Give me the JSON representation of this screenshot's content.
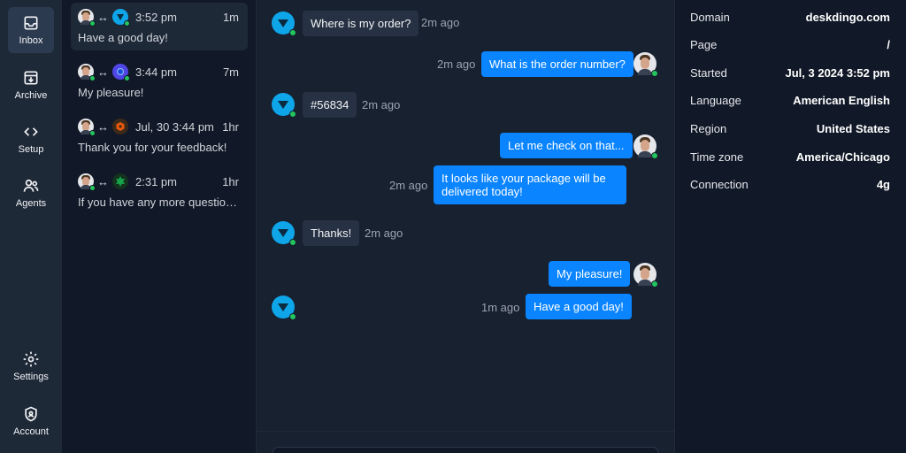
{
  "nav": {
    "inbox": "Inbox",
    "archive": "Archive",
    "setup": "Setup",
    "agents": "Agents",
    "settings": "Settings",
    "account": "Account"
  },
  "conversations": [
    {
      "time": "3:52 pm",
      "ago": "1m",
      "message": "Have a good day!",
      "brand": "bot-blue"
    },
    {
      "time": "3:44 pm",
      "ago": "7m",
      "message": "My pleasure!",
      "brand": "bot-purple"
    },
    {
      "time": "Jul, 30 3:44 pm",
      "ago": "1hr",
      "message": "Thank you for your feedback!",
      "brand": "bot-orange"
    },
    {
      "time": "2:31 pm",
      "ago": "1hr",
      "message": "If you have any more questions…",
      "brand": "bot-green"
    }
  ],
  "messages": [
    {
      "from": "visitor",
      "text": "Where is my order?",
      "time": "2m ago"
    },
    {
      "from": "agent",
      "text": "What is the order number?",
      "time": "2m ago"
    },
    {
      "from": "visitor",
      "text": "#56834",
      "time": "2m ago"
    },
    {
      "from": "agent",
      "text": "Let me check on that...",
      "time": ""
    },
    {
      "from": "agent",
      "text": "It looks like your package will be delivered today!",
      "time": "2m ago"
    },
    {
      "from": "visitor",
      "text": "Thanks!",
      "time": "2m ago"
    },
    {
      "from": "agent",
      "text": "My pleasure!",
      "time": ""
    },
    {
      "from": "agent",
      "text": "Have a good day!",
      "time": "1m ago"
    }
  ],
  "details": [
    {
      "label": "Domain",
      "value": "deskdingo.com"
    },
    {
      "label": "Page",
      "value": "/"
    },
    {
      "label": "Started",
      "value": "Jul, 3 2024 3:52 pm"
    },
    {
      "label": "Language",
      "value": "American English"
    },
    {
      "label": "Region",
      "value": "United States"
    },
    {
      "label": "Time zone",
      "value": "America/Chicago"
    },
    {
      "label": "Connection",
      "value": "4g"
    }
  ],
  "colors": {
    "accent": "#0a84ff",
    "online": "#22c55e",
    "background": "#111827"
  }
}
